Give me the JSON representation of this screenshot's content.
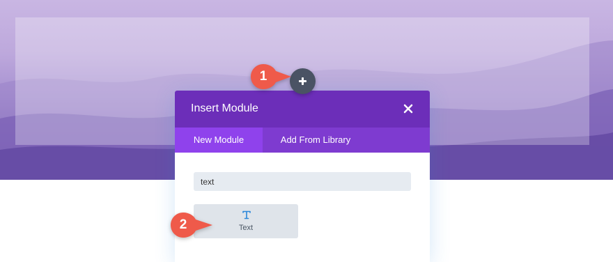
{
  "modal": {
    "title": "Insert Module",
    "tabs": [
      {
        "label": "New Module",
        "active": true
      },
      {
        "label": "Add From Library",
        "active": false
      }
    ],
    "search": {
      "value": "text",
      "placeholder": ""
    },
    "modules": [
      {
        "label": "Text",
        "icon": "text-module-icon"
      }
    ]
  },
  "callouts": [
    {
      "number": "1"
    },
    {
      "number": "2"
    }
  ],
  "colors": {
    "header": "#6c2eb9",
    "tab_bar": "#7e3bd0",
    "tab_active": "#8f42ec",
    "callout": "#ef5a4a",
    "add_button": "#4a5364"
  },
  "icons": [
    "plus-icon",
    "close-icon",
    "text-module-icon"
  ]
}
